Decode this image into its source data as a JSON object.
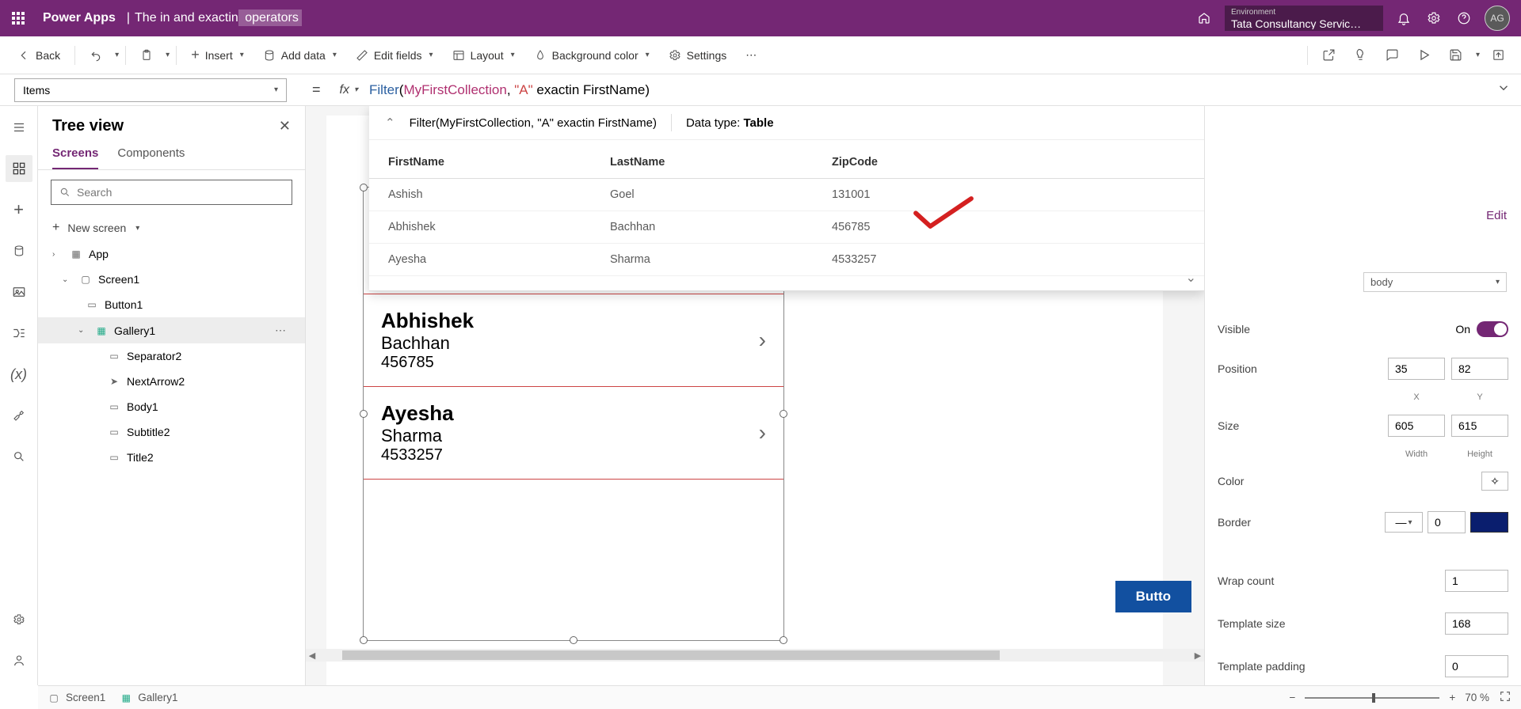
{
  "header": {
    "app_name": "Power Apps",
    "title_prefix": "The in and exactin",
    "title_hl": " operators",
    "env_label": "Environment",
    "env_value": "Tata Consultancy Servic…",
    "avatar": "AG"
  },
  "toolbar": {
    "back": "Back",
    "insert": "Insert",
    "add_data": "Add data",
    "edit_fields": "Edit fields",
    "layout": "Layout",
    "bg_color": "Background color",
    "settings": "Settings"
  },
  "property_bar": {
    "property": "Items",
    "formula_fn": "Filter",
    "formula_col": "MyFirstCollection",
    "formula_str": "\"A\"",
    "formula_rest1": " exactin FirstName)",
    "result_line": "Filter(MyFirstCollection, \"A\" exactin FirstName)",
    "data_type_lbl": "Data type: ",
    "data_type": "Table"
  },
  "result_table": {
    "columns": [
      "FirstName",
      "LastName",
      "ZipCode"
    ],
    "rows": [
      {
        "FirstName": "Ashish",
        "LastName": "Goel",
        "ZipCode": "131001"
      },
      {
        "FirstName": "Abhishek",
        "LastName": "Bachhan",
        "ZipCode": "456785"
      },
      {
        "FirstName": "Ayesha",
        "LastName": "Sharma",
        "ZipCode": "4533257"
      }
    ]
  },
  "tree": {
    "title": "Tree view",
    "tabs": {
      "screens": "Screens",
      "components": "Components"
    },
    "search_ph": "Search",
    "new_screen": "New screen",
    "items": {
      "app": "App",
      "screen1": "Screen1",
      "button1": "Button1",
      "gallery1": "Gallery1",
      "separator2": "Separator2",
      "nextarrow2": "NextArrow2",
      "body1": "Body1",
      "subtitle2": "Subtitle2",
      "title2": "Title2"
    }
  },
  "gallery": {
    "rows": [
      {
        "title": "Abhishek",
        "sub": "Bachhan",
        "body": "456785"
      },
      {
        "title": "Ayesha",
        "sub": "Sharma",
        "body": "4533257"
      }
    ],
    "button": "Butto"
  },
  "props": {
    "edit": "Edit",
    "body_lbl": "body",
    "visible": "Visible",
    "visible_on": "On",
    "position": "Position",
    "pos_x": "35",
    "pos_y": "82",
    "pos_xl": "X",
    "pos_yl": "Y",
    "size": "Size",
    "size_w": "605",
    "size_h": "615",
    "size_wl": "Width",
    "size_hl": "Height",
    "color": "Color",
    "border": "Border",
    "border_w": "0",
    "wrap": "Wrap count",
    "wrap_v": "1",
    "tsize": "Template size",
    "tsize_v": "168",
    "tpad": "Template padding",
    "tpad_v": "0"
  },
  "bottom": {
    "screen1": "Screen1",
    "gallery1": "Gallery1",
    "zoom": "70  %"
  }
}
